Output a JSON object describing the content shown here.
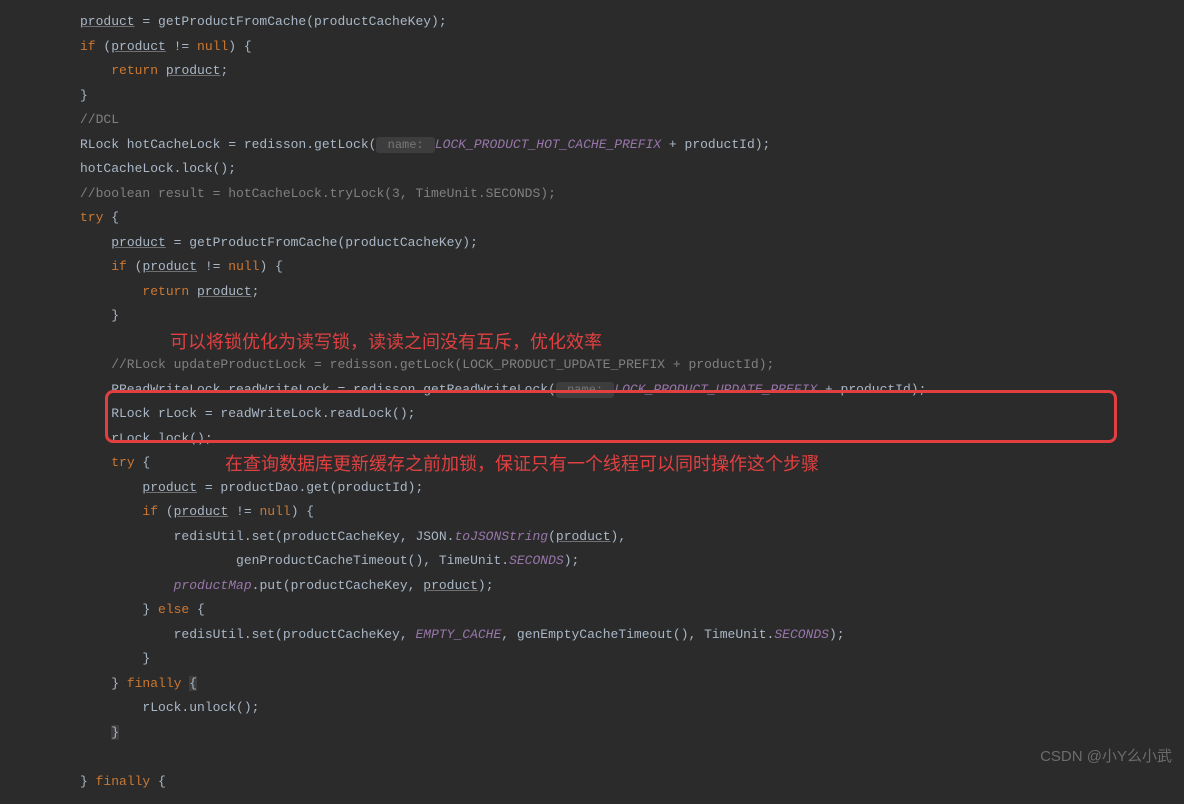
{
  "code": {
    "l1_a": "product",
    "l1_b": " = getProductFromCache(productCacheKey);",
    "l2_a": "if",
    "l2_b": " (",
    "l2_c": "product",
    "l2_d": " != ",
    "l2_e": "null",
    "l2_f": ") {",
    "l3_a": "    ",
    "l3_b": "return",
    "l3_c": " ",
    "l3_d": "product",
    "l3_e": ";",
    "l4": "}",
    "l5": "//DCL",
    "l6_a": "RLock hotCacheLock = redisson.getLock(",
    "l6_hint": " name: ",
    "l6_b": "LOCK_PRODUCT_HOT_CACHE_PREFIX",
    "l6_c": " + productId);",
    "l7": "hotCacheLock.lock();",
    "l8": "//boolean result = hotCacheLock.tryLock(3, TimeUnit.SECONDS);",
    "l9_a": "try",
    "l9_b": " {",
    "l10_a": "    ",
    "l10_b": "product",
    "l10_c": " = getProductFromCache(productCacheKey);",
    "l11_a": "    ",
    "l11_b": "if",
    "l11_c": " (",
    "l11_d": "product",
    "l11_e": " != ",
    "l11_f": "null",
    "l11_g": ") {",
    "l12_a": "        ",
    "l12_b": "return",
    "l12_c": " ",
    "l12_d": "product",
    "l12_e": ";",
    "l13": "    }",
    "l14_blank": "",
    "l15": "    //RLock updateProductLock = redisson.getLock(LOCK_PRODUCT_UPDATE_PREFIX + productId);",
    "l16_a": "    RReadWriteLock readWriteLock = redisson.getReadWriteLock(",
    "l16_hint": " name: ",
    "l16_b": "LOCK_PRODUCT_UPDATE_PREFIX",
    "l16_c": " + productId);",
    "l17": "    RLock rLock = readWriteLock.readLock();",
    "l18": "    rLock.lock();",
    "l19_a": "    ",
    "l19_b": "try",
    "l19_c": " {",
    "l20_a": "        ",
    "l20_b": "product",
    "l20_c": " = productDao.get(productId);",
    "l21_a": "        ",
    "l21_b": "if",
    "l21_c": " (",
    "l21_d": "product",
    "l21_e": " != ",
    "l21_f": "null",
    "l21_g": ") {",
    "l22_a": "            redisUtil.set(productCacheKey, JSON.",
    "l22_b": "toJSONString",
    "l22_c": "(",
    "l22_d": "product",
    "l22_e": "),",
    "l23_a": "                    genProductCacheTimeout(), TimeUnit.",
    "l23_b": "SECONDS",
    "l23_c": ");",
    "l24_a": "            ",
    "l24_b": "productMap",
    "l24_c": ".put(productCacheKey, ",
    "l24_d": "product",
    "l24_e": ");",
    "l25_a": "        } ",
    "l25_b": "else",
    "l25_c": " {",
    "l26_a": "            redisUtil.set(productCacheKey, ",
    "l26_b": "EMPTY_CACHE",
    "l26_c": ", genEmptyCacheTimeout(), TimeUnit.",
    "l26_d": "SECONDS",
    "l26_e": ");",
    "l27": "        }",
    "l28_a": "    } ",
    "l28_b": "finally",
    "l28_c": " ",
    "l28_d": "{",
    "l29": "        rLock.unlock();",
    "l30_a": "    ",
    "l30_b": "}",
    "l31_blank": "",
    "l32_a": "} ",
    "l32_b": "finally",
    "l32_c": " {"
  },
  "annotations": {
    "red1": "可以将锁优化为读写锁，读读之间没有互斥，优化效率",
    "red2": "在查询数据库更新缓存之前加锁，保证只有一个线程可以同时操作这个步骤"
  },
  "watermark": "CSDN @小Y么小武"
}
